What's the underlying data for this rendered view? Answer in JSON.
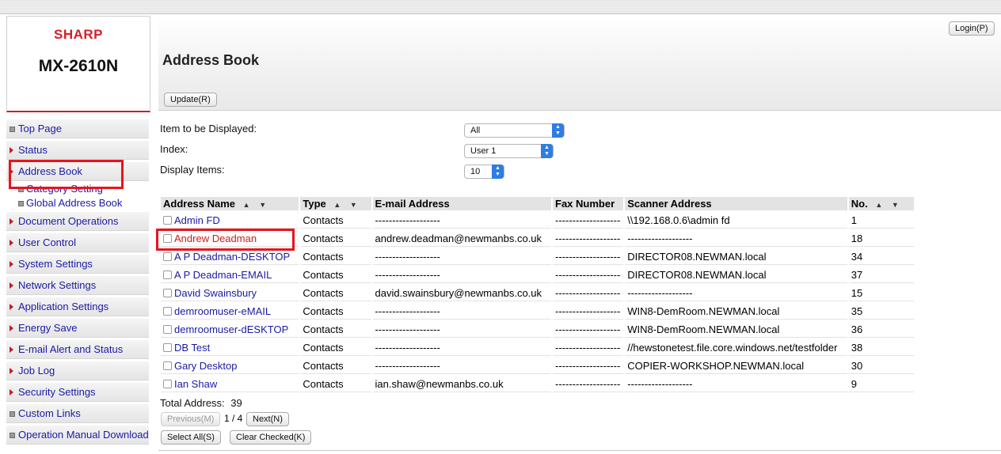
{
  "brand": {
    "logo": "SHARP",
    "model": "MX-2610N"
  },
  "nav": {
    "items": [
      {
        "label": "Top Page",
        "marker": "square"
      },
      {
        "label": "Status",
        "marker": "arrow"
      },
      {
        "label": "Address Book",
        "marker": "arrow"
      },
      {
        "label": "Category Setting",
        "marker": "square"
      },
      {
        "label": "Global Address Book",
        "marker": "square"
      },
      {
        "label": "Document Operations",
        "marker": "arrow"
      },
      {
        "label": "User Control",
        "marker": "arrow"
      },
      {
        "label": "System Settings",
        "marker": "arrow"
      },
      {
        "label": "Network Settings",
        "marker": "arrow"
      },
      {
        "label": "Application Settings",
        "marker": "arrow"
      },
      {
        "label": "Energy Save",
        "marker": "arrow"
      },
      {
        "label": "E-mail Alert and Status",
        "marker": "arrow"
      },
      {
        "label": "Job Log",
        "marker": "arrow"
      },
      {
        "label": "Security Settings",
        "marker": "arrow"
      },
      {
        "label": "Custom Links",
        "marker": "square"
      },
      {
        "label": "Operation Manual Download",
        "marker": "square"
      }
    ]
  },
  "header": {
    "login_label": "Login(P)",
    "title": "Address Book",
    "update_label": "Update(R)"
  },
  "filters": {
    "item_label": "Item to be Displayed:",
    "item_value": "All",
    "index_label": "Index:",
    "index_value": "User 1",
    "display_label": "Display Items:",
    "display_value": "10"
  },
  "table": {
    "columns": [
      "Address Name",
      "Type",
      "E-mail Address",
      "Fax Number",
      "Scanner Address",
      "No."
    ],
    "rows": [
      [
        "Admin FD",
        "Contacts",
        "-------------------",
        "-------------------",
        "\\\\192.168.0.6\\admin fd",
        "1"
      ],
      [
        "Andrew Deadman",
        "Contacts",
        "andrew.deadman@newmanbs.co.uk",
        "-------------------",
        "-------------------",
        "18"
      ],
      [
        "A P Deadman-DESKTOP",
        "Contacts",
        "-------------------",
        "-------------------",
        "DIRECTOR08.NEWMAN.local",
        "34"
      ],
      [
        "A P Deadman-EMAIL",
        "Contacts",
        "-------------------",
        "-------------------",
        "DIRECTOR08.NEWMAN.local",
        "37"
      ],
      [
        "David Swainsbury",
        "Contacts",
        "david.swainsbury@newmanbs.co.uk",
        "-------------------",
        "-------------------",
        "15"
      ],
      [
        "demroomuser-eMAIL",
        "Contacts",
        "-------------------",
        "-------------------",
        "WIN8-DemRoom.NEWMAN.local",
        "35"
      ],
      [
        "demroomuser-dESKTOP",
        "Contacts",
        "-------------------",
        "-------------------",
        "WIN8-DemRoom.NEWMAN.local",
        "36"
      ],
      [
        "DB Test",
        "Contacts",
        "-------------------",
        "-------------------",
        "//hewstonetest.file.core.windows.net/testfolder",
        "38"
      ],
      [
        "Gary Desktop",
        "Contacts",
        "-------------------",
        "-------------------",
        "COPIER-WORKSHOP.NEWMAN.local",
        "30"
      ],
      [
        "Ian Shaw",
        "Contacts",
        "ian.shaw@newmanbs.co.uk",
        "-------------------",
        "-------------------",
        "9"
      ]
    ]
  },
  "footer": {
    "total_label": "Total Address:",
    "total_value": "39",
    "prev_label": "Previous(M)",
    "page_indicator": "1 / 4",
    "next_label": "Next(N)",
    "select_all_label": "Select All(S)",
    "clear_checked_label": "Clear Checked(K)"
  },
  "colors": {
    "accent_red": "#e8141d",
    "link_blue": "#1a1aa6",
    "brand_red": "#d2202a",
    "select_blue": "#2e7de1"
  }
}
